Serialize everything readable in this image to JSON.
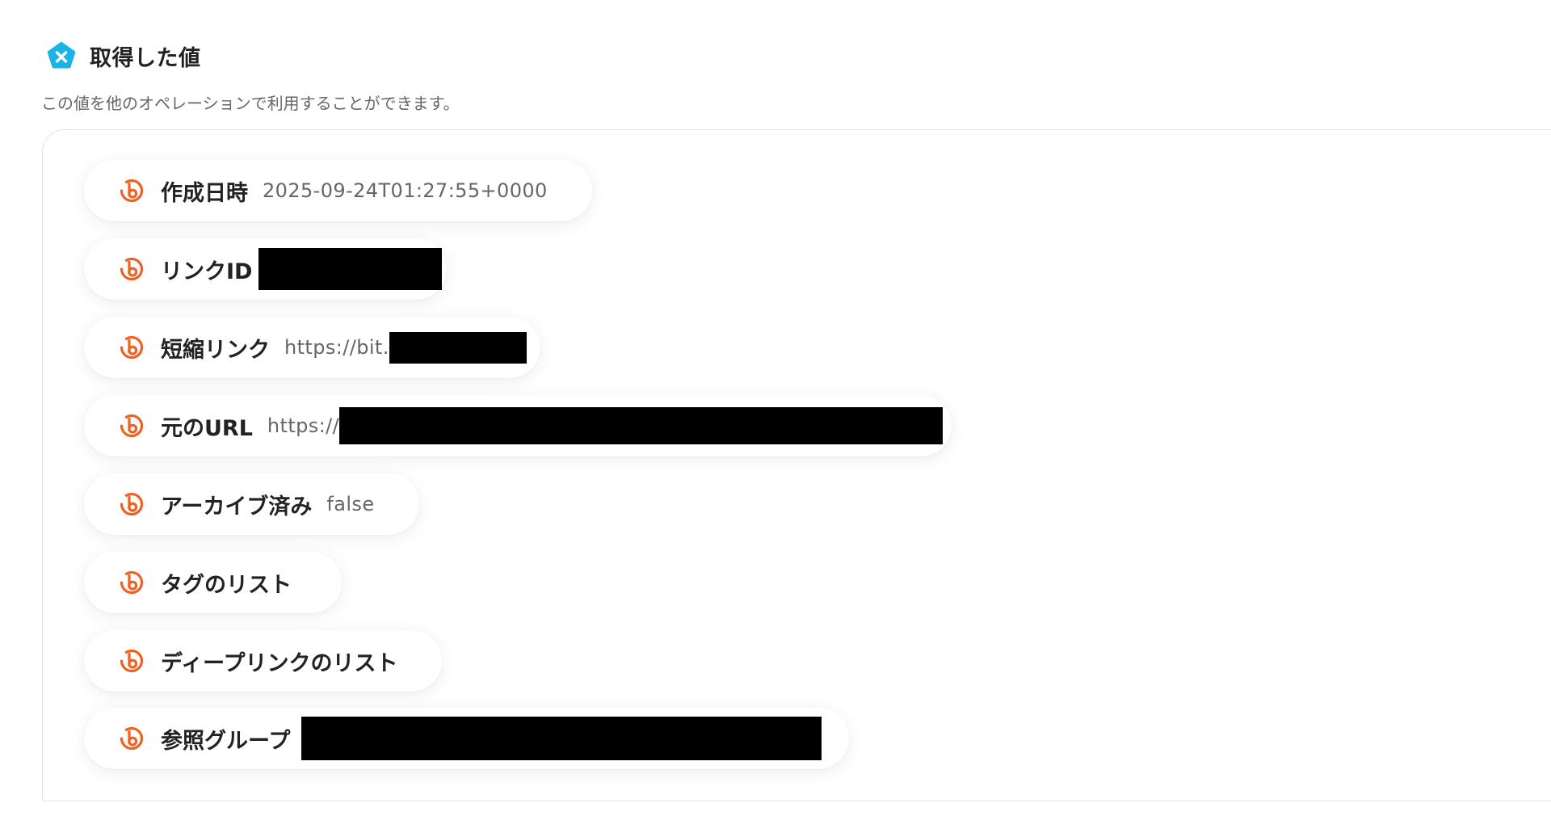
{
  "header": {
    "title": "取得した値",
    "subtitle": "この値を他のオペレーションで利用することができます。",
    "icon": "pentagon-x-icon",
    "icon_color": "#1ab3e8"
  },
  "fields": [
    {
      "label": "作成日時",
      "value": "2025-09-24T01:27:55+0000",
      "redacted": false
    },
    {
      "label": "リンクID",
      "value": "",
      "redacted": true
    },
    {
      "label": "短縮リンク",
      "value": "https://bit.",
      "redacted": true
    },
    {
      "label": "元のURL",
      "value": "https://",
      "redacted": true
    },
    {
      "label": "アーカイブ済み",
      "value": "false",
      "redacted": false
    },
    {
      "label": "タグのリスト",
      "value": "",
      "redacted": false
    },
    {
      "label": "ディープリンクのリスト",
      "value": "",
      "redacted": false
    },
    {
      "label": "参照グループ",
      "value": "",
      "redacted": true
    }
  ],
  "colors": {
    "bitly_orange": "#ee6123",
    "label": "#222222",
    "value": "#666666",
    "redaction": "#000000"
  }
}
